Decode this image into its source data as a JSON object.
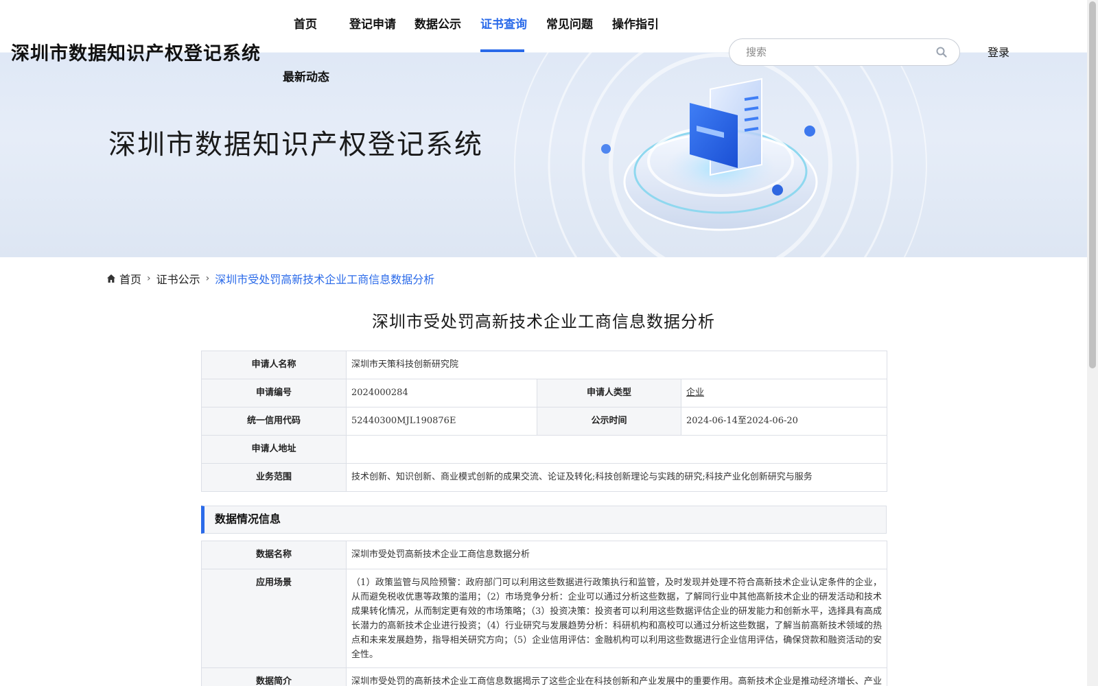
{
  "site": {
    "title": "深圳市数据知识产权登记系统",
    "hero_title": "深圳市数据知识产权登记系统"
  },
  "nav": {
    "items": [
      {
        "label": "首页"
      },
      {
        "label": "登记申请"
      },
      {
        "label": "数据公示"
      },
      {
        "label": "证书查询",
        "active": true
      },
      {
        "label": "常见问题"
      },
      {
        "label": "操作指引"
      },
      {
        "label": "最新动态"
      }
    ]
  },
  "search": {
    "placeholder": "搜索",
    "value": ""
  },
  "login": {
    "label": "登录"
  },
  "breadcrumb": {
    "home": "首页",
    "section": "证书公示",
    "current": "深圳市受处罚高新技术企业工商信息数据分析"
  },
  "page_title": "深圳市受处罚高新技术企业工商信息数据分析",
  "applicant": {
    "name_label": "申请人名称",
    "name_value": "深圳市天策科技创新研究院",
    "number_label": "申请编号",
    "number_value": "2024000284",
    "type_label": "申请人类型",
    "type_value": "企业",
    "credit_label": "统一信用代码",
    "credit_value": "52440300MJL190876E",
    "publish_label": "公示时间",
    "publish_value": "2024-06-14至2024-06-20",
    "address_label": "申请人地址",
    "address_value": "",
    "scope_label": "业务范围",
    "scope_value": "技术创新、知识创新、商业模式创新的成果交流、论证及转化;科技创新理论与实践的研究;科技产业化创新研究与服务"
  },
  "data_section": {
    "header": "数据情况信息",
    "name_label": "数据名称",
    "name_value": "深圳市受处罚高新技术企业工商信息数据分析",
    "scenario_label": "应用场景",
    "scenario_value": "（1）政策监管与风险预警：政府部门可以利用这些数据进行政策执行和监管，及时发现并处理不符合高新技术企业认定条件的企业，从而避免税收优惠等政策的滥用；（2）市场竞争分析：企业可以通过分析这些数据，了解同行业中其他高新技术企业的研发活动和技术成果转化情况，从而制定更有效的市场策略；（3）投资决策：投资者可以利用这些数据评估企业的研发能力和创新水平，选择具有高成长潜力的高新技术企业进行投资；（4）行业研究与发展趋势分析：科研机构和高校可以通过分析这些数据，了解当前高新技术领域的热点和未来发展趋势，指导相关研究方向；（5）企业信用评估：金融机构可以利用这些数据进行企业信用评估，确保贷款和融资活动的安全性。",
    "intro_label": "数据简介",
    "intro_value": "深圳市受处罚的高新技术企业工商信息数据揭示了这些企业在科技创新和产业发展中的重要作用。高新技术企业是推动经济增长、产业优化和结构调整的关键力量。通过分析这些数据，可以更好地理解企业的研发能力和市场表现，进而为政策制定和资"
  },
  "colors": {
    "accent": "#2a6ae9",
    "key_bg": "#f5f6f8",
    "border": "#dcdfe6"
  }
}
